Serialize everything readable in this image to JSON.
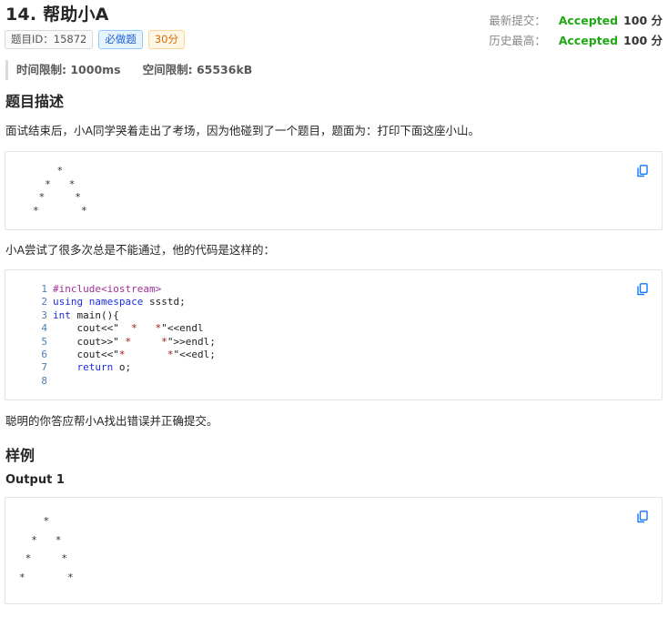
{
  "problem": {
    "title": "14.  帮助小A",
    "tags": {
      "id_label": "题目ID：15872",
      "required_label": "必做题",
      "points_label": "30分"
    },
    "status": {
      "latest_label": "最新提交：",
      "latest_result": "Accepted",
      "latest_score": "100 分",
      "best_label": "历史最高：",
      "best_result": "Accepted",
      "best_score": "100 分"
    },
    "limits": {
      "time": "时间限制: 1000ms",
      "memory": "空间限制: 65536kB"
    }
  },
  "description": {
    "heading": "题目描述",
    "intro": "面试结束后，小A同学哭着走出了考场，因为他碰到了一个题目，题面为：打印下面这座小山。",
    "mountain_art": "    *\n  *   *\n *     *\n*       *",
    "middle": "小A尝试了很多次总是不能通过，他的代码是这样的：",
    "code_lines": [
      {
        "n": "1",
        "parts": [
          {
            "t": "#include<iostream>",
            "c": "pp"
          }
        ]
      },
      {
        "n": "2",
        "parts": [
          {
            "t": "using namespace",
            "c": "kw"
          },
          {
            "t": " ssstd;",
            "c": "plain"
          }
        ]
      },
      {
        "n": "3",
        "parts": [
          {
            "t": "int",
            "c": "kw"
          },
          {
            "t": " main(){",
            "c": "plain"
          }
        ]
      },
      {
        "n": "4",
        "parts": [
          {
            "t": "    cout<<\"",
            "c": "plain"
          },
          {
            "t": "  *   *",
            "c": "str"
          },
          {
            "t": "\"<<endl",
            "c": "plain"
          }
        ]
      },
      {
        "n": "5",
        "parts": [
          {
            "t": "    cout>>\"",
            "c": "plain"
          },
          {
            "t": " *     *",
            "c": "str"
          },
          {
            "t": "\">>endl;",
            "c": "plain"
          }
        ]
      },
      {
        "n": "6",
        "parts": [
          {
            "t": "    cout<<\"",
            "c": "plain"
          },
          {
            "t": "*       *",
            "c": "str"
          },
          {
            "t": "\"<<edl;",
            "c": "plain"
          }
        ]
      },
      {
        "n": "7",
        "parts": [
          {
            "t": "    ",
            "c": "plain"
          },
          {
            "t": "return",
            "c": "kw"
          },
          {
            "t": " o;",
            "c": "plain"
          }
        ]
      },
      {
        "n": "8",
        "parts": [
          {
            "t": "",
            "c": "plain"
          }
        ]
      }
    ],
    "outro": "聪明的你答应帮小A找出错误并正确提交。"
  },
  "samples": {
    "heading": "样例",
    "output_label": "Output 1",
    "output_art": "    *\n  *   *\n *     *\n*       *"
  },
  "icons": {
    "copy": "copy-icon"
  },
  "colors": {
    "accepted": "#1fa814",
    "link_blue": "#1d5fd1"
  }
}
